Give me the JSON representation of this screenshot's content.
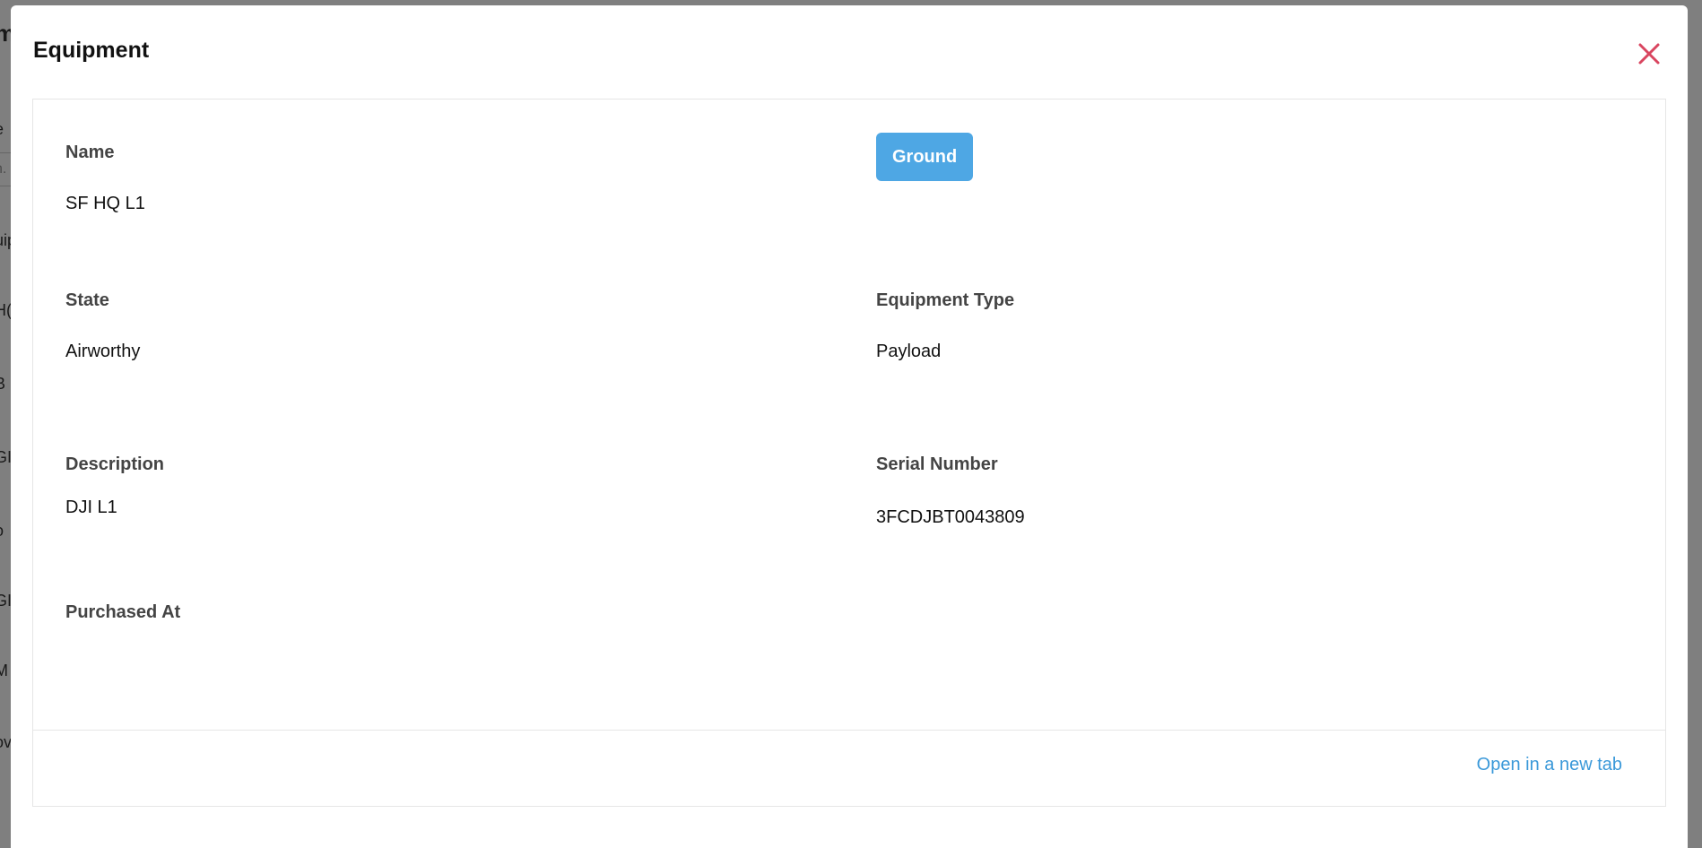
{
  "background": {
    "fragments": [
      "m",
      "e",
      "h.",
      "uip",
      "H(",
      "B",
      "GI",
      "o",
      "GI",
      "M",
      "ov"
    ]
  },
  "modal": {
    "title": "Equipment",
    "close_icon": "close-icon",
    "accent_color": "#d9455f"
  },
  "details": {
    "name_label": "Name",
    "name_value": "SF HQ L1",
    "badge_label": "Ground",
    "badge_color": "#4ea7e4",
    "state_label": "State",
    "state_value": "Airworthy",
    "equipment_type_label": "Equipment Type",
    "equipment_type_value": "Payload",
    "description_label": "Description",
    "description_value": "DJI L1",
    "serial_number_label": "Serial Number",
    "serial_number_value": "3FCDJBT0043809",
    "purchased_at_label": "Purchased At",
    "purchased_at_value": ""
  },
  "footer": {
    "open_link_label": "Open in a new tab",
    "link_color": "#3b99d9"
  }
}
